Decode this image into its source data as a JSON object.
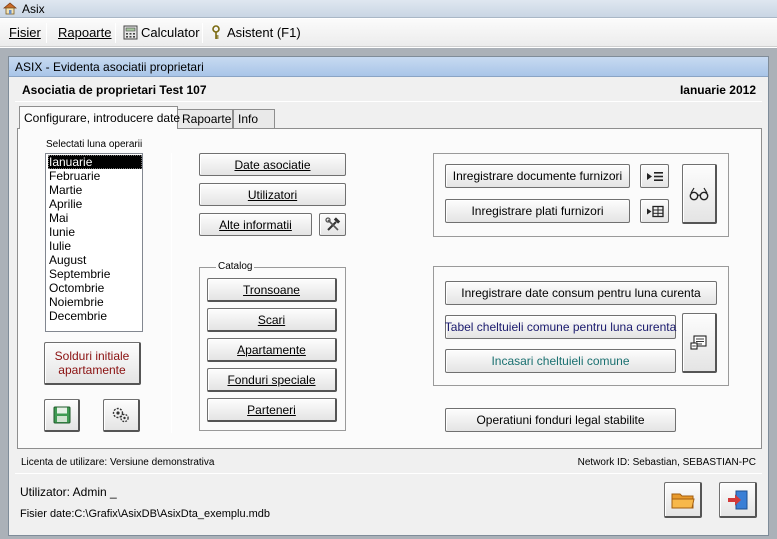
{
  "app": {
    "title": "Asix"
  },
  "menu": {
    "fisier": "Fisier",
    "rapoarte": "Rapoarte",
    "calculator": "Calculator",
    "asistent": "Asistent (F1)"
  },
  "window": {
    "title": "ASIX - Evidenta asociatii proprietari",
    "association": "Asociatia de proprietari Test 107",
    "period": "Ianuarie 2012"
  },
  "tabs": [
    "Configurare, introducere date",
    "Rapoarte",
    "Info"
  ],
  "months": {
    "label": "Selectati luna operarii",
    "selected_index": 0,
    "items": [
      "Ianuarie",
      "Februarie",
      "Martie",
      "Aprilie",
      "Mai",
      "Iunie",
      "Iulie",
      "August",
      "Septembrie",
      "Octombrie",
      "Noiembrie",
      "Decembrie"
    ]
  },
  "buttons": {
    "solduri_line1": "Solduri initiale",
    "solduri_line2": "apartamente",
    "date_asociatie": "Date asociatie",
    "utilizatori": "Utilizatori",
    "alte_informatii": "Alte informatii",
    "tronsoane": "Tronsoane",
    "scari": "Scari",
    "apartamente": "Apartamente",
    "fonduri_speciale": "Fonduri speciale",
    "parteneri": "Parteneri",
    "inregistrare_documente": "Inregistrare documente furnizori",
    "inregistrare_plati": "Inregistrare plati furnizori",
    "inregistrare_consum": "Inregistrare date consum pentru luna curenta",
    "tabel_cheltuieli": "Tabel cheltuieli comune pentru luna curenta",
    "incasari": "Incasari cheltuieli comune",
    "operatiuni_fonduri": "Operatiuni fonduri legal stabilite"
  },
  "catalog": {
    "label": "Catalog"
  },
  "status": {
    "license": "Licenta de utilizare: Versiune demonstrativa",
    "network": "Network ID: Sebastian, SEBASTIAN-PC",
    "user": "Utilizator: Admin _",
    "file": "Fisier date:C:\\Grafix\\AsixDB\\AsixDta_exemplu.mdb"
  },
  "icons": {
    "app": "home-icon",
    "calculator": "calculator-icon",
    "asistent": "key-icon",
    "tools": "tools-icon",
    "save": "floppy-disk-icon",
    "settings": "gears-icon",
    "list_arrow": "list-arrow-icon",
    "table_arrow": "table-arrow-icon",
    "glasses": "glasses-icon",
    "report": "report-icon",
    "folder": "folder-icon",
    "exit": "exit-door-icon"
  },
  "colors": {
    "accent_title": "#b8cfee",
    "work_area": "#abb1b8",
    "navy_text": "#1a1a6e",
    "teal_text": "#1a7070",
    "dark_red_text": "#8a1010"
  }
}
